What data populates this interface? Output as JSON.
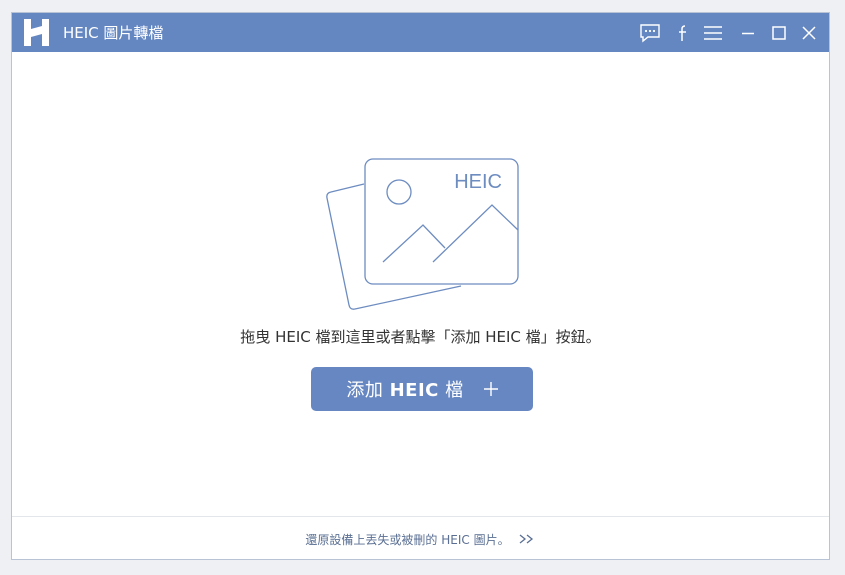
{
  "window": {
    "title": "HEIC 圖片轉檔"
  },
  "colors": {
    "titlebar": "#6487c2",
    "accent": "#6687c2",
    "illustration": "#6d8cc0",
    "text": "#333333",
    "link": "#5a6f93"
  },
  "titlebar_icons": [
    "feedback-icon",
    "facebook-icon",
    "menu-icon",
    "minimize-icon",
    "maximize-icon",
    "close-icon"
  ],
  "main": {
    "illustration_label": "HEIC",
    "instruction": "拖曳 HEIC 檔到這里或者點擊「添加 HEIC 檔」按鈕。",
    "add_button": {
      "prefix": "添加",
      "bold": "HEIC",
      "suffix": "檔"
    }
  },
  "footer": {
    "recover_link": "還原設備上丟失或被刪的 HEIC 圖片。"
  }
}
